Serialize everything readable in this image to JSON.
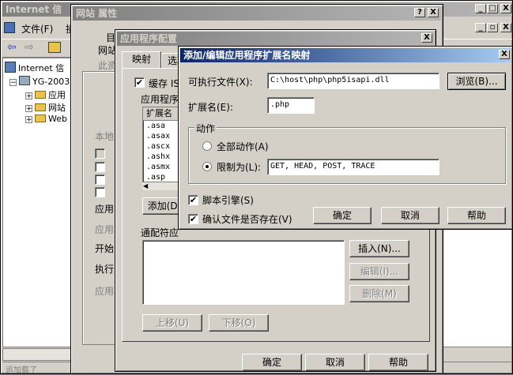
{
  "mmc": {
    "title": "Internet 信",
    "menu_file": "文件(F)",
    "menu_action": "操",
    "tree": [
      {
        "label": "Internet 信"
      },
      {
        "label": "YG-2003"
      },
      {
        "label": "应用"
      },
      {
        "label": "网站"
      },
      {
        "label": "Web ."
      }
    ],
    "controls": {
      "min": "_",
      "max": "□",
      "close": "X"
    },
    "status": "追加载了"
  },
  "site_props": {
    "title": "网站 属性",
    "help": "?",
    "close": "X",
    "tab_dir": "目",
    "tab_site": "网站",
    "text_this": "此资",
    "section_local": "本地",
    "label_app1": "应用",
    "label_app2": "应用",
    "label_start": "开始",
    "label_exec": "执行",
    "label_app3": "应用",
    "ok": "确定",
    "cancel": "取消",
    "help_btn": "帮助"
  },
  "app_config": {
    "title": "应用程序配置",
    "close": "X",
    "tab_mapping": "映射",
    "tab_options": "选项",
    "cache_label": "缓存 IS",
    "group_mappings": "应用程序",
    "col_ext": "扩展名",
    "extensions": [
      ".asa",
      ".asax",
      ".ascx",
      ".ashx",
      ".asmx",
      ".asp"
    ],
    "add_btn": "添加(D)",
    "wildcard_label": "通配符应",
    "insert_btn": "插入(N)...",
    "edit_btn": "编辑(I)...",
    "delete_btn": "删除(M)",
    "move_up": "上移(U)",
    "move_down": "下移(O)",
    "ok": "确定",
    "cancel": "取消",
    "help": "帮助"
  },
  "ext_dialog": {
    "title": "添加/编辑应用程序扩展名映射",
    "close": "X",
    "exe_label": "可执行文件(X):",
    "exe_value": "C:\\host\\php\\php5isapi.dll",
    "browse": "浏览(B)...",
    "ext_label": "扩展名(E):",
    "ext_value": ".php",
    "verbs_group": "动作",
    "all_verbs": "全部动作(A)",
    "limit_to": "限制为(L):",
    "limit_value": "GET, HEAD, POST, TRACE",
    "script_engine": "脚本引擎(S)",
    "verify_file": "确认文件是否存在(V)",
    "ok": "确定",
    "cancel": "取消",
    "help": "帮助"
  }
}
